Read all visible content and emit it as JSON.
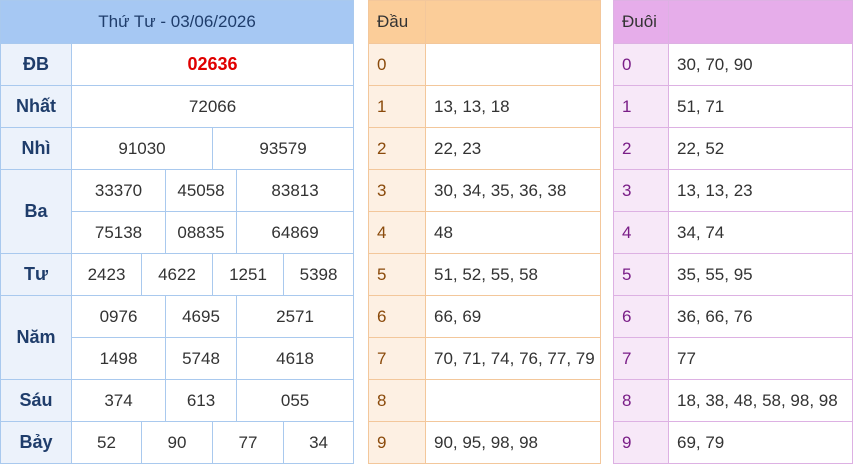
{
  "results": {
    "date_header": "Thứ Tư - 03/06/2026",
    "prizes": [
      {
        "label": "ĐB",
        "numbers": [
          "02636"
        ]
      },
      {
        "label": "Nhất",
        "numbers": [
          "72066"
        ]
      },
      {
        "label": "Nhì",
        "numbers": [
          "91030",
          "93579"
        ]
      },
      {
        "label": "Ba",
        "numbers": [
          "33370",
          "45058",
          "83813",
          "75138",
          "08835",
          "64869"
        ]
      },
      {
        "label": "Tư",
        "numbers": [
          "2423",
          "4622",
          "1251",
          "5398"
        ]
      },
      {
        "label": "Năm",
        "numbers": [
          "0976",
          "4695",
          "2571",
          "1498",
          "5748",
          "4618"
        ]
      },
      {
        "label": "Sáu",
        "numbers": [
          "374",
          "613",
          "055"
        ]
      },
      {
        "label": "Bảy",
        "numbers": [
          "52",
          "90",
          "77",
          "34"
        ]
      }
    ]
  },
  "dau": {
    "header": "Đầu",
    "rows": [
      {
        "key": "0",
        "values": ""
      },
      {
        "key": "1",
        "values": "13, 13, 18"
      },
      {
        "key": "2",
        "values": "22, 23"
      },
      {
        "key": "3",
        "values": "30, 34, 35, 36, 38"
      },
      {
        "key": "4",
        "values": "48"
      },
      {
        "key": "5",
        "values": "51, 52, 55, 58"
      },
      {
        "key": "6",
        "values": "66, 69"
      },
      {
        "key": "7",
        "values": "70, 71, 74, 76, 77, 79"
      },
      {
        "key": "8",
        "values": ""
      },
      {
        "key": "9",
        "values": "90, 95, 98, 98"
      }
    ]
  },
  "duoi": {
    "header": "Đuôi",
    "rows": [
      {
        "key": "0",
        "values": "30, 70, 90"
      },
      {
        "key": "1",
        "values": "51, 71"
      },
      {
        "key": "2",
        "values": "22, 52"
      },
      {
        "key": "3",
        "values": "13, 13, 23"
      },
      {
        "key": "4",
        "values": "34, 74"
      },
      {
        "key": "5",
        "values": "35, 55, 95"
      },
      {
        "key": "6",
        "values": "36, 66, 76"
      },
      {
        "key": "7",
        "values": "77"
      },
      {
        "key": "8",
        "values": "18, 38, 48, 58, 98, 98"
      },
      {
        "key": "9",
        "values": "69, 79"
      }
    ]
  },
  "colors": {
    "special_prize": "#e00000",
    "results_header": "#a6c8f3",
    "dau_header": "#fbcd99",
    "duoi_header": "#e6adea"
  }
}
